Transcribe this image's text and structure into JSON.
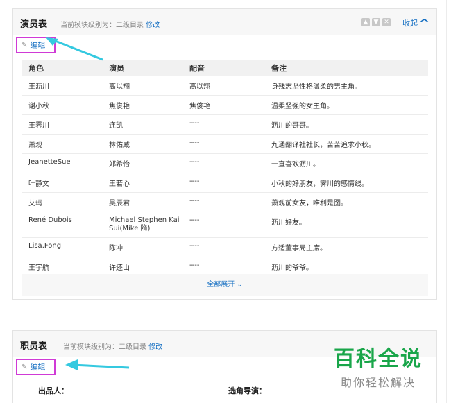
{
  "cast_panel": {
    "title": "演员表",
    "module_label": "当前模块级别为：二级目录",
    "module_edit": "修改",
    "collapse_label": "收起",
    "edit_label": "编辑",
    "columns": [
      "角色",
      "演员",
      "配音",
      "备注"
    ],
    "rows": [
      [
        "王沥川",
        "高以翔",
        "高以翔",
        "身残志坚性格温柔的男主角。"
      ],
      [
        "谢小秋",
        "焦俊艳",
        "焦俊艳",
        "温柔坚强的女主角。"
      ],
      [
        "王霁川",
        "连凯",
        "----",
        "沥川的哥哥。"
      ],
      [
        "萧观",
        "林佑威",
        "----",
        "九通翻译社社长，苦苦追求小秋。"
      ],
      [
        "JeanetteSue",
        "郑希怡",
        "----",
        "一直喜欢沥川。"
      ],
      [
        "叶静文",
        "王若心",
        "----",
        "小秋的好朋友，霁川的感情线。"
      ],
      [
        "艾玛",
        "吴辰君",
        "----",
        "萧观前女友，唯利是图。"
      ],
      [
        "René Dubois",
        "Michael Stephen Kai Sui(Mike 隋)",
        "----",
        "沥川好友。"
      ],
      [
        "Lisa.Fong",
        "陈冲",
        "----",
        "方适董事局主席。"
      ],
      [
        "王宇航",
        "许还山",
        "----",
        "沥川的爷爷。"
      ]
    ],
    "expand_all": "全部展开"
  },
  "staff_panel": {
    "title": "职员表",
    "module_label": "当前模块级别为：二级目录",
    "module_edit": "修改",
    "edit_label": "编辑",
    "producer_label": "出品人：",
    "casting_label": "选角导演："
  },
  "watermark": {
    "title": "百科全说",
    "subtitle": "助你轻松解决"
  },
  "colors": {
    "link": "#136ec2",
    "highlight_border": "#d03ad6",
    "arrow": "#35c9e0",
    "watermark_green": "#19a64a"
  }
}
